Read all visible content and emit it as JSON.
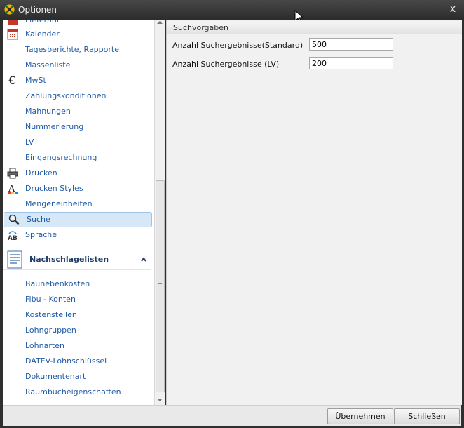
{
  "window": {
    "title": "Optionen",
    "close_label": "x"
  },
  "sidebar": {
    "items": [
      {
        "label": "Lieferant",
        "icon": "supplier-icon"
      },
      {
        "label": "Kalender",
        "icon": "calendar-icon"
      },
      {
        "label": "Tagesberichte, Rapporte",
        "icon": ""
      },
      {
        "label": "Massenliste",
        "icon": ""
      },
      {
        "label": "MwSt",
        "icon": "euro-icon"
      },
      {
        "label": "Zahlungskonditionen",
        "icon": ""
      },
      {
        "label": "Mahnungen",
        "icon": ""
      },
      {
        "label": "Nummerierung",
        "icon": ""
      },
      {
        "label": "LV",
        "icon": ""
      },
      {
        "label": "Eingangsrechnung",
        "icon": ""
      },
      {
        "label": "Drucken",
        "icon": "printer-icon"
      },
      {
        "label": "Drucken Styles",
        "icon": "font-style-icon"
      },
      {
        "label": "Mengeneinheiten",
        "icon": ""
      },
      {
        "label": "Suche",
        "icon": "search-icon",
        "selected": true
      },
      {
        "label": "Sprache",
        "icon": "language-icon"
      }
    ],
    "group": {
      "label": "Nachschlagelisten",
      "icon": "document-list-icon"
    },
    "group_items": [
      {
        "label": "Baunebenkosten"
      },
      {
        "label": "Fibu - Konten"
      },
      {
        "label": "Kostenstellen"
      },
      {
        "label": "Lohngruppen"
      },
      {
        "label": "Lohnarten"
      },
      {
        "label": "DATEV-Lohnschlüssel"
      },
      {
        "label": "Dokumentenart"
      },
      {
        "label": "Raumbucheigenschaften"
      }
    ]
  },
  "content": {
    "section_title": "Suchvorgaben",
    "fields": [
      {
        "label": "Anzahl Suchergebnisse(Standard)",
        "value": "500"
      },
      {
        "label": "Anzahl Suchergebnisse (LV)",
        "value": "200"
      }
    ]
  },
  "footer": {
    "apply_label": "Übernehmen",
    "close_label": "Schließen"
  },
  "colors": {
    "link": "#1f5aa6",
    "selection": "#d6e8f7",
    "title_bar": "#3a3a3a"
  }
}
